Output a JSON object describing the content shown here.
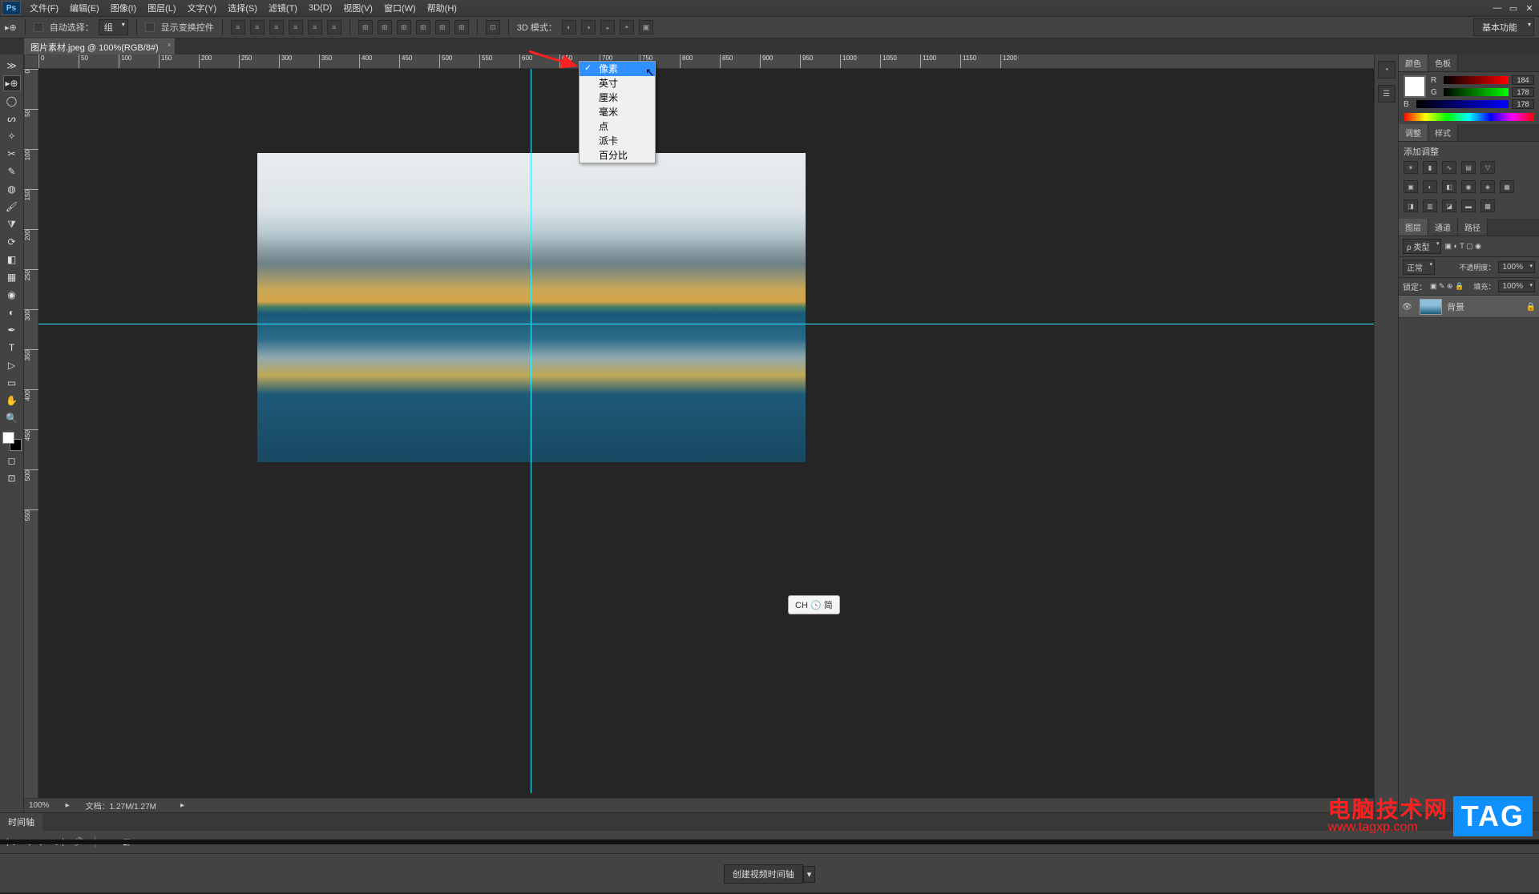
{
  "app": {
    "logo": "Ps"
  },
  "menubar": [
    "文件(F)",
    "编辑(E)",
    "图像(I)",
    "图层(L)",
    "文字(Y)",
    "选择(S)",
    "滤镜(T)",
    "3D(D)",
    "视图(V)",
    "窗口(W)",
    "帮助(H)"
  ],
  "optionsbar": {
    "auto_select": "自动选择：",
    "group": "组",
    "show_transform": "显示变换控件",
    "mode_3d": "3D 模式：",
    "workspace": "基本功能"
  },
  "doc_tab": {
    "title": "图片素材.jpeg @ 100%(RGB/8#)"
  },
  "ruler_h_ticks": [
    0,
    50,
    100,
    150,
    200,
    250,
    300,
    350,
    400,
    450,
    500,
    550,
    600,
    650,
    700,
    750,
    800,
    850,
    900,
    950,
    1000,
    1050,
    1100,
    1150,
    1200
  ],
  "ruler_v_ticks": [
    0,
    50,
    100,
    150,
    200,
    250,
    300,
    350,
    400,
    450,
    500,
    550
  ],
  "context_menu": {
    "items": [
      "像素",
      "英寸",
      "厘米",
      "毫米",
      "点",
      "派卡",
      "百分比"
    ],
    "selected": 0
  },
  "status": {
    "zoom": "100%",
    "doc": "文档：1.27M/1.27M"
  },
  "rightpanels": {
    "color": {
      "tab1": "颜色",
      "tab2": "色板",
      "r": "R",
      "g": "G",
      "b": "B",
      "r_val": "184",
      "g_val": "178",
      "b_val": "178"
    },
    "adjust": {
      "tab1": "调整",
      "tab2": "样式",
      "header": "添加调整"
    },
    "layers": {
      "tab1": "图层",
      "tab2": "通道",
      "tab3": "路径",
      "kind": "ρ 类型",
      "blend": "正常",
      "opacity_label": "不透明度：",
      "opacity": "100%",
      "lock_label": "锁定：",
      "fill_label": "填充：",
      "fill": "100%",
      "layer_name": "背景"
    }
  },
  "timeline": {
    "tab": "时间轴",
    "create_btn": "创建视频时间轴"
  },
  "ch_badge": "CH 🕓 简",
  "watermark": {
    "line1": "电脑技术网",
    "line2": "www.tagxp.com",
    "tag": "TAG"
  }
}
